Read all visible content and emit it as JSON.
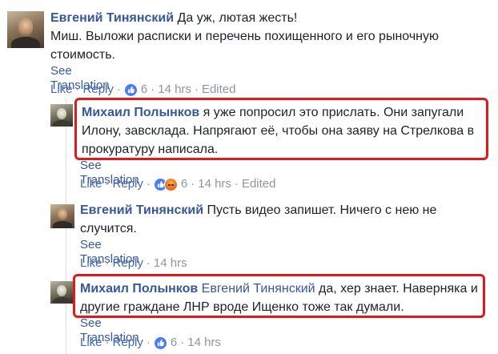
{
  "comments": [
    {
      "author": "Евгений Тинянский",
      "text_line1": "Да уж, лютая жесть!",
      "text_line2": "Миш. Выложи расписки и перечень похищенного и его рыночную",
      "text_line3": "стоимость.",
      "see_translation": "See Translation",
      "like": "Like",
      "reply": "Reply",
      "reaction_count": "6",
      "time": "14 hrs",
      "edited": "Edited"
    },
    {
      "author": "Михаил Полынков",
      "text_line1": "я уже попросил это прислать. Они запугали",
      "text_line2": "Илону, завсклада. Напрягают её, чтобы она заяву на Стрелкова в",
      "text_line3": "прокуратуру написала.",
      "see_translation": "See Translation",
      "like": "Like",
      "reply": "Reply",
      "reaction_count": "6",
      "time": "14 hrs",
      "edited": "Edited"
    },
    {
      "author": "Евгений Тинянский",
      "text_line1": "Пусть видео запишет. Ничего с нею не",
      "text_line2": "случится.",
      "see_translation": "See Translation",
      "like": "Like",
      "reply": "Reply",
      "time": "14 hrs"
    },
    {
      "author": "Михаил Полынков",
      "mention": "Евгений Тинянский",
      "text_line1": "да, хер знает. Наверняка и",
      "text_line2": "другие граждане ЛНР вроде Ищенко тоже так думали.",
      "see_translation": "See Translation",
      "like": "Like",
      "reply": "Reply",
      "reaction_count": "6",
      "time": "14 hrs"
    }
  ],
  "separator": "·",
  "colors": {
    "link": "#365899",
    "action_link": "#4267b2",
    "muted": "#90949c",
    "highlight": "#e0191d"
  },
  "icons": {
    "like": "thumbs-up-icon",
    "angry": "angry-face-icon"
  }
}
